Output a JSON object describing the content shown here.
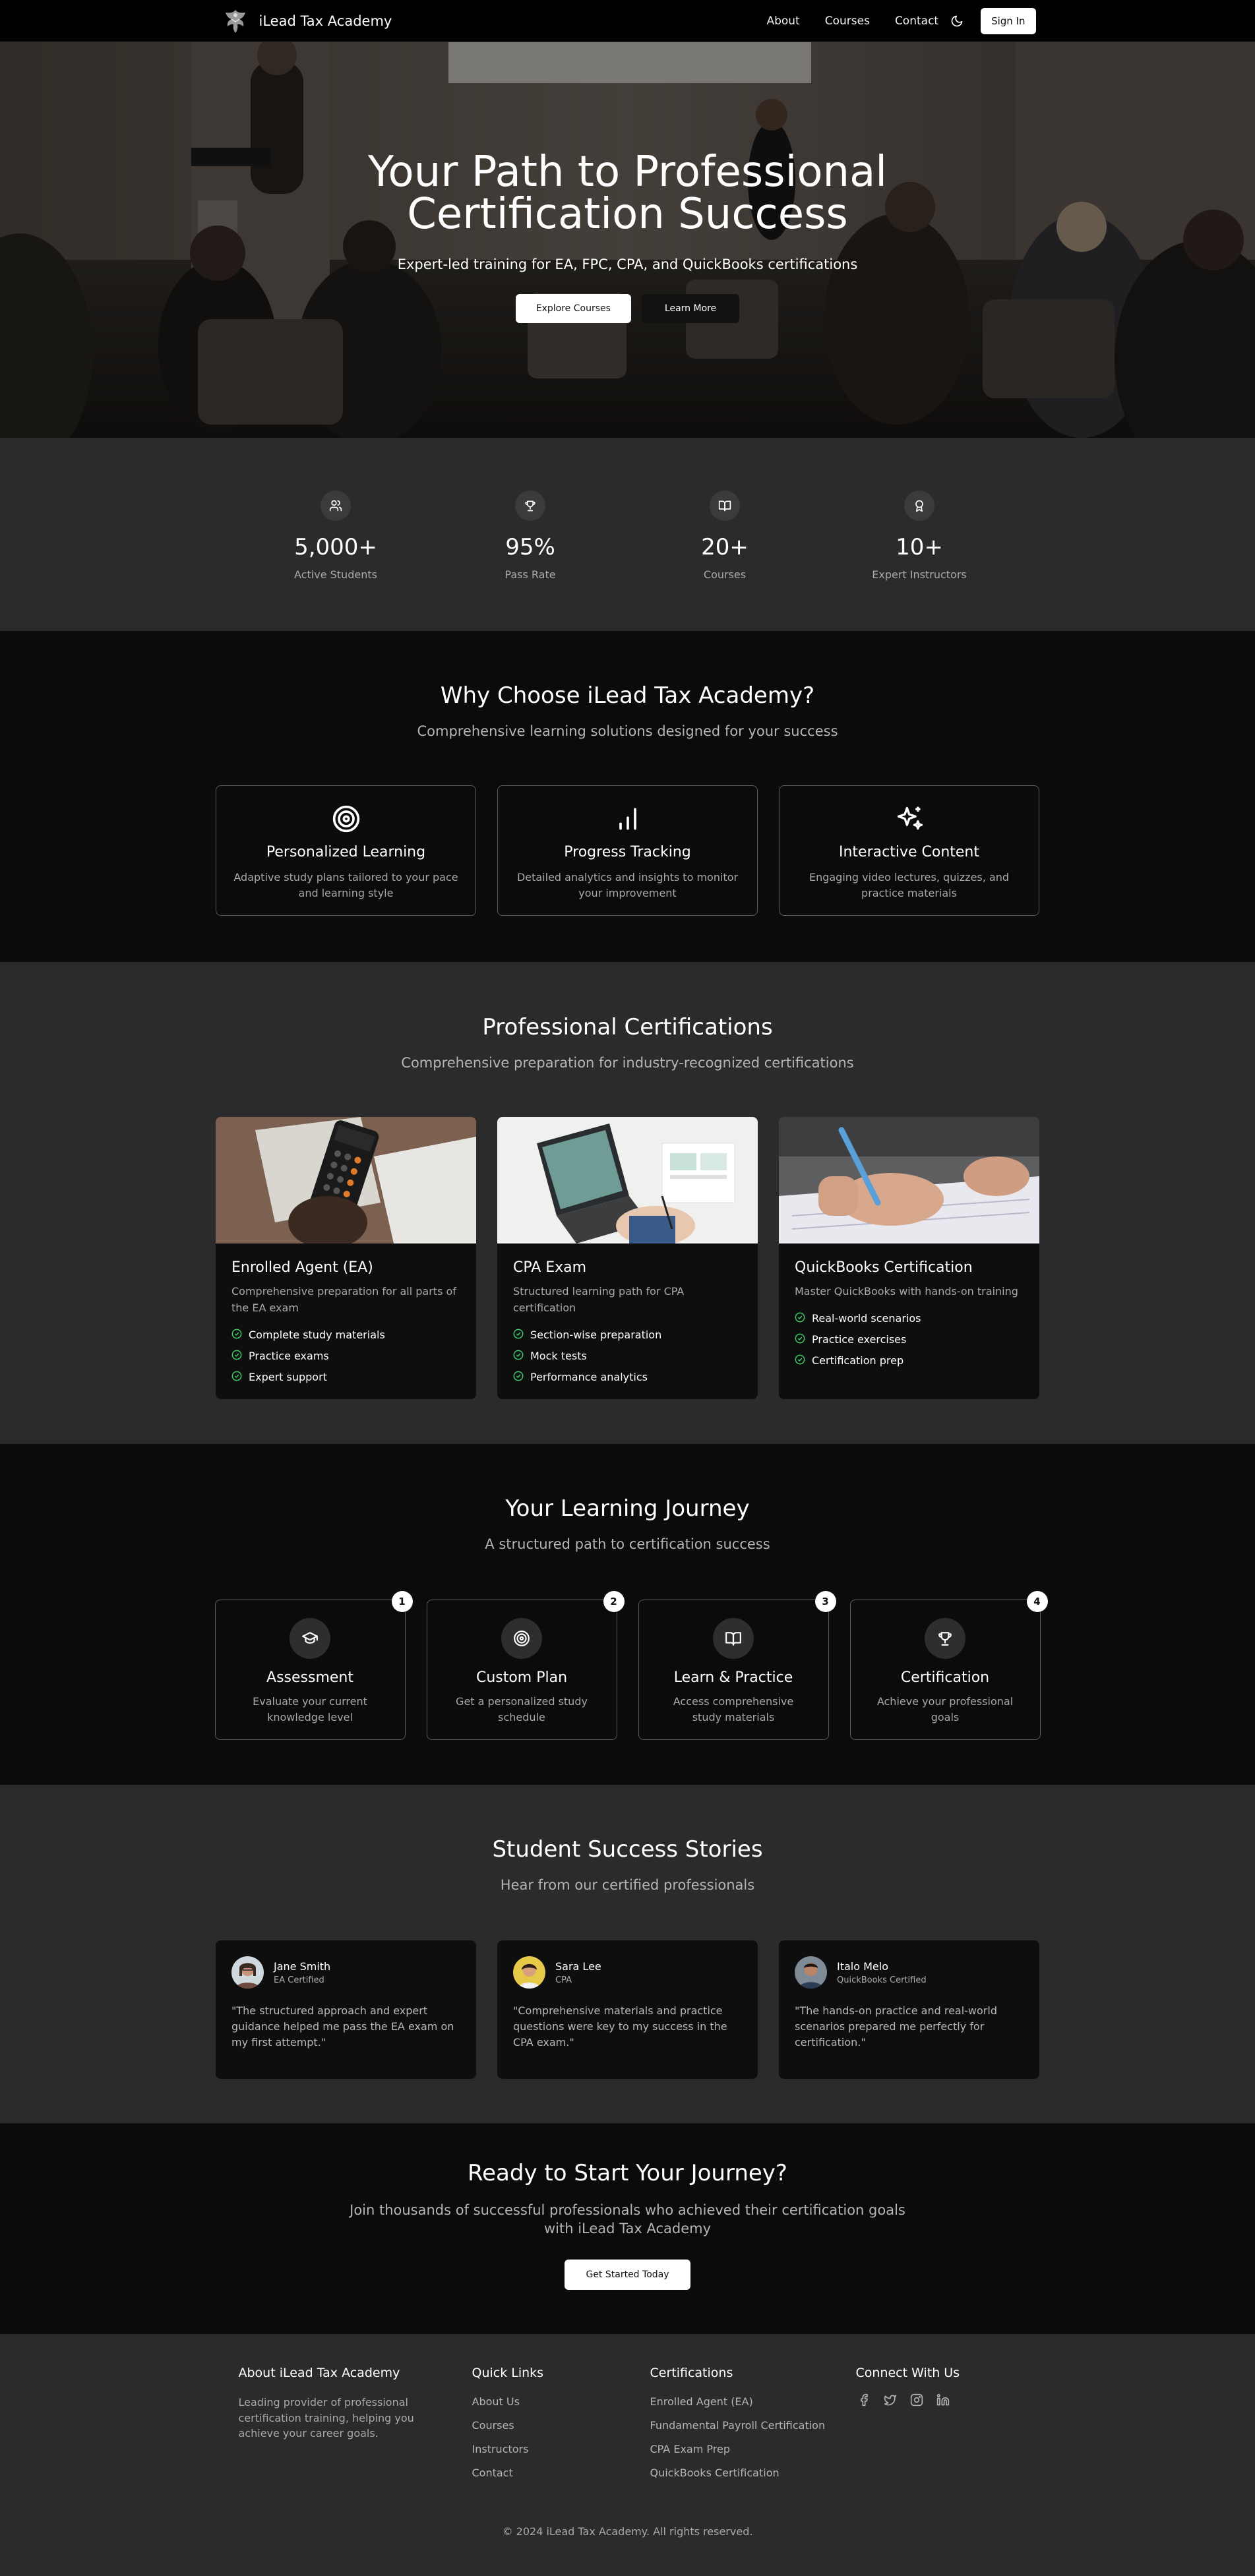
{
  "nav": {
    "brand": "iLead Tax Academy",
    "links": [
      "About",
      "Courses",
      "Contact"
    ],
    "signin": "Sign In"
  },
  "hero": {
    "title_line1": "Your Path to Professional",
    "title_line2": "Certification Success",
    "subtitle": "Expert-led training for EA, FPC, CPA, and QuickBooks certifications",
    "primary_cta": "Explore Courses",
    "secondary_cta": "Learn More"
  },
  "stats": [
    {
      "icon": "users-icon",
      "value": "5,000+",
      "label": "Active Students"
    },
    {
      "icon": "trophy-icon",
      "value": "95%",
      "label": "Pass Rate"
    },
    {
      "icon": "book-icon",
      "value": "20+",
      "label": "Courses"
    },
    {
      "icon": "award-icon",
      "value": "10+",
      "label": "Expert Instructors"
    }
  ],
  "why": {
    "title": "Why Choose iLead Tax Academy?",
    "subtitle": "Comprehensive learning solutions designed for your success",
    "features": [
      {
        "icon": "target-icon",
        "title": "Personalized Learning",
        "desc": "Adaptive study plans tailored to your pace and learning style"
      },
      {
        "icon": "bar-chart-icon",
        "title": "Progress Tracking",
        "desc": "Detailed analytics and insights to monitor your improvement"
      },
      {
        "icon": "sparkles-icon",
        "title": "Interactive Content",
        "desc": "Engaging video lectures, quizzes, and practice materials"
      }
    ]
  },
  "certs": {
    "title": "Professional Certifications",
    "subtitle": "Comprehensive preparation for industry-recognized certifications",
    "cards": [
      {
        "title": "Enrolled Agent (EA)",
        "desc": "Comprehensive preparation for all parts of the EA exam",
        "items": [
          "Complete study materials",
          "Practice exams",
          "Expert support"
        ]
      },
      {
        "title": "CPA Exam",
        "desc": "Structured learning path for CPA certification",
        "items": [
          "Section-wise preparation",
          "Mock tests",
          "Performance analytics"
        ]
      },
      {
        "title": "QuickBooks Certification",
        "desc": "Master QuickBooks with hands-on training",
        "items": [
          "Real-world scenarios",
          "Practice exercises",
          "Certification prep"
        ]
      }
    ]
  },
  "journey": {
    "title": "Your Learning Journey",
    "subtitle": "A structured path to certification success",
    "steps": [
      {
        "num": "1",
        "icon": "graduation-cap-icon",
        "title": "Assessment",
        "desc": "Evaluate your current knowledge level"
      },
      {
        "num": "2",
        "icon": "target-icon",
        "title": "Custom Plan",
        "desc": "Get a personalized study schedule"
      },
      {
        "num": "3",
        "icon": "book-open-icon",
        "title": "Learn & Practice",
        "desc": "Access comprehensive study materials"
      },
      {
        "num": "4",
        "icon": "trophy-icon",
        "title": "Certification",
        "desc": "Achieve your professional goals"
      }
    ]
  },
  "stories": {
    "title": "Student Success Stories",
    "subtitle": "Hear from our certified professionals",
    "items": [
      {
        "name": "Jane Smith",
        "role": "EA Certified",
        "quote": "\"The structured approach and expert guidance helped me pass the EA exam on my first attempt.\""
      },
      {
        "name": "Sara Lee",
        "role": "CPA",
        "quote": "\"Comprehensive materials and practice questions were key to my success in the CPA exam.\""
      },
      {
        "name": "Italo Melo",
        "role": "QuickBooks Certified",
        "quote": "\"The hands-on practice and real-world scenarios prepared me perfectly for certification.\""
      }
    ]
  },
  "cta": {
    "title": "Ready to Start Your Journey?",
    "subtitle": "Join thousands of successful professionals who achieved their certification goals with iLead Tax Academy",
    "button": "Get Started Today"
  },
  "footer": {
    "about_title": "About iLead Tax Academy",
    "about_text": "Leading provider of professional certification training, helping you achieve your career goals.",
    "quick_title": "Quick Links",
    "quick_links": [
      "About Us",
      "Courses",
      "Instructors",
      "Contact"
    ],
    "cert_title": "Certifications",
    "cert_links": [
      "Enrolled Agent (EA)",
      "Fundamental Payroll Certification",
      "CPA Exam Prep",
      "QuickBooks Certification"
    ],
    "connect_title": "Connect With Us",
    "socials": [
      "facebook-icon",
      "twitter-icon",
      "instagram-icon",
      "linkedin-icon"
    ],
    "copyright": "© 2024 iLead Tax Academy. All rights reserved."
  }
}
